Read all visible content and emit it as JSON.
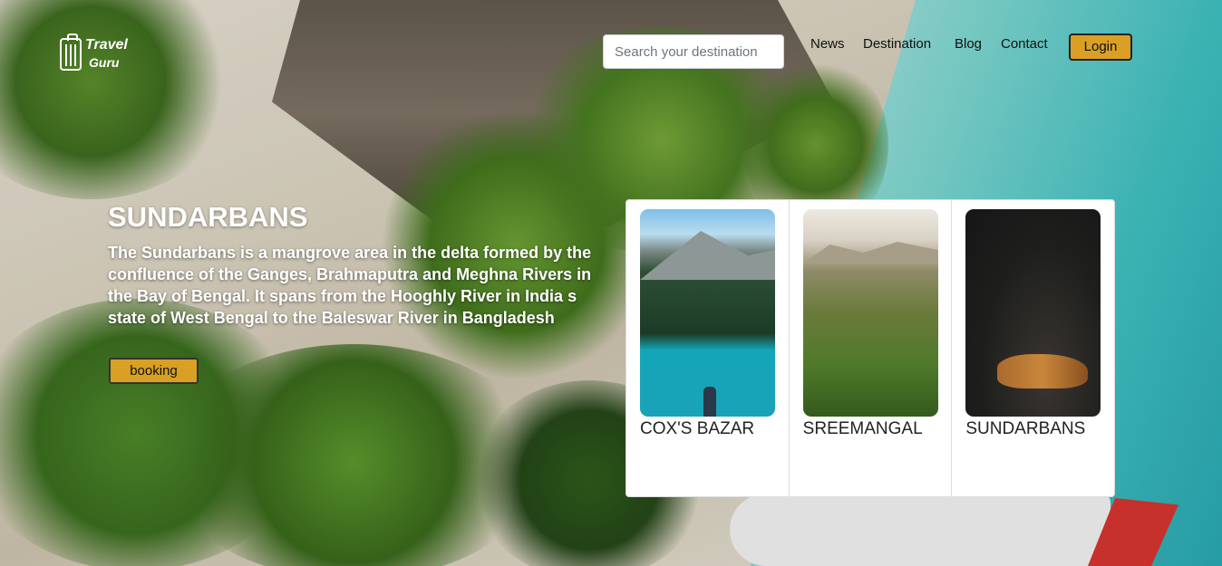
{
  "header": {
    "logo": {
      "line1": "Travel",
      "line2": "Guru"
    },
    "search_placeholder": "Search your destination",
    "nav": [
      "News",
      "Destination",
      "Blog",
      "Contact"
    ],
    "login_label": "Login"
  },
  "hero": {
    "title": "SUNDARBANS",
    "description": "The Sundarbans is a mangrove area in the delta formed by the confluence of the Ganges, Brahmaputra and Meghna Rivers in the Bay of Bengal. It spans from the Hooghly River in India s state of West Bengal to the Baleswar River in Bangladesh",
    "button_label": "booking"
  },
  "destinations": [
    {
      "name": "COX'S BAZAR"
    },
    {
      "name": "SREEMANGAL"
    },
    {
      "name": "SUNDARBANS"
    }
  ],
  "colors": {
    "accent": "#d9a025"
  }
}
